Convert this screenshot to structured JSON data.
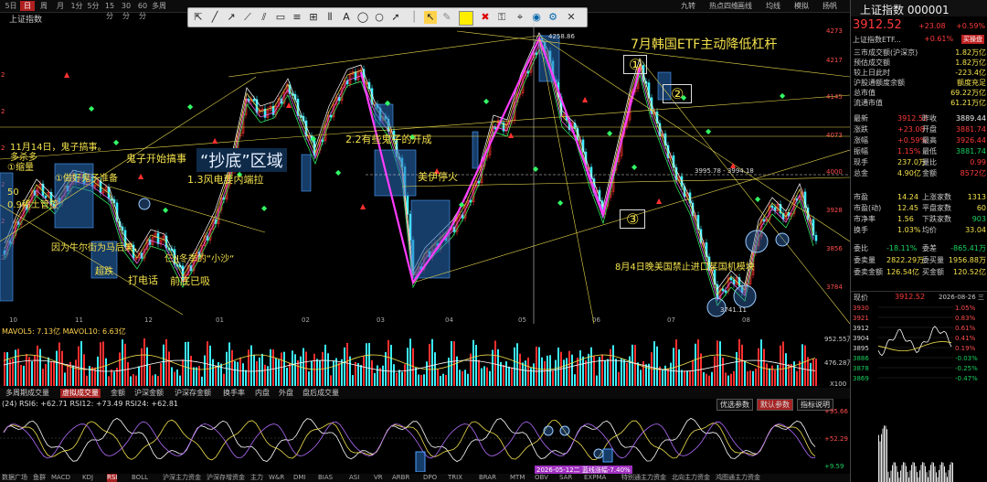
{
  "periods": [
    "5日",
    "日",
    "周",
    "月",
    "1分",
    "5分",
    "15分",
    "30分",
    "60分",
    "多周"
  ],
  "active_period": "日",
  "right_tabs": [
    "九转",
    "热点四维",
    "画线",
    "均线",
    "模拟",
    "扬帆"
  ],
  "chart_title": "上证指数",
  "price_axis": [
    "4273",
    "4217",
    "4145",
    "4073",
    "4000",
    "3928",
    "3856",
    "3784"
  ],
  "month_axis": [
    "10",
    "11",
    "12",
    "01",
    "02",
    "03",
    "04",
    "05",
    "06",
    "07",
    "08"
  ],
  "annotations": {
    "nov14": "11月14日，鬼子搞事。",
    "duo_sha": "多杀多",
    "suo_liang": "①缩量",
    "guizi_ready": "①做好鬼子准备",
    "guizi_start": "鬼子开始搞事",
    "chaodi": "“抄底”区域",
    "ratio_1_3": "1.3风电要内端拉",
    "note_2_2": "2.2有些鬼子的开成",
    "fed": "美伊停火",
    "korea": "7月韩国ETF主动降低杠杆",
    "aug4": "8月4日晚美国禁止进口某国机模块",
    "pct_50": "50",
    "xi_tu": "0.9稀土管控",
    "usjp": "因为牛尔街为马后果，",
    "chao_die": "超跌",
    "dial": "打电话",
    "prev_bottom": "前底已吸",
    "jj": "仨JJ冬季的“小沙“",
    "price_high": "4258.86",
    "price_low": "3741.11",
    "right_note": "3995.78 - 3994.18",
    "circle1": "①",
    "circle2": "②",
    "circle3": "③",
    "date_marker": "2026-05-12二 蓝线涨幅-7.40%"
  },
  "volume": {
    "header": "MAVOL5: 7.13亿  MAVOL10: 6.63亿",
    "axis_top": "952.55万",
    "axis_mid": "476.28万",
    "axis_unit": "X100"
  },
  "volume_tabs": [
    "多周期成交量",
    "虚拟成交量",
    "金额",
    "沪深金额",
    "沪深存金额",
    "换手率",
    "内盘",
    "外盘",
    "盘后成交量"
  ],
  "active_volume_tab": "虚拟成交量",
  "rsi": {
    "label": "(24) RSI6: +62.71  RSI12: +73.49  RSI24: +62.81",
    "buttons": [
      "优选参数",
      "默认参数",
      "指标说明"
    ],
    "axis": [
      "+95.66",
      "+52.29",
      "+9.59"
    ]
  },
  "bottom_tabs": [
    "数据广场",
    "鱼群",
    "MACD",
    "KDJ",
    "RSI",
    "BOLL",
    "沪深主力资金",
    "沪深存增资金",
    "主力",
    "W&R",
    "DMI",
    "BIAS",
    "ASI",
    "VR",
    "ARBR",
    "DPO",
    "TRIX",
    "BRAR",
    "MTM",
    "OBV",
    "SAR",
    "EXPMA",
    "特别通主力资金",
    "北向主力资金",
    "鸿图通主力资金"
  ],
  "active_bottom_tab": "RSI",
  "quote": {
    "title": "上证指数 000001",
    "price": "3912.52",
    "change": "+23.08",
    "pct": "+0.59%",
    "badge": "买操盘",
    "etf_label": "上证指数ETF...",
    "etf_pct": "+0.61%",
    "rows": [
      {
        "l": "三市成交额(沪深京)",
        "v": "1.82万亿"
      },
      {
        "l": "预估成交额",
        "v": "1.82万亿"
      },
      {
        "l": "较上日此时",
        "v": "-223.4亿"
      },
      {
        "l": "沪股通额度余额",
        "v": "额度充足"
      },
      {
        "l": "总市值",
        "v": "69.22万亿"
      },
      {
        "l": "流通市值",
        "v": "61.21万亿"
      }
    ],
    "grid": [
      [
        "最新",
        "3912.52",
        "昨收",
        "3889.44"
      ],
      [
        "涨跌",
        "+23.08",
        "开盘",
        "3881.74"
      ],
      [
        "涨幅",
        "+0.59%",
        "最高",
        "3926.44"
      ],
      [
        "振幅",
        "1.15%",
        "最低",
        "3881.74"
      ],
      [
        "现手",
        "237.0万",
        "量比",
        "0.99"
      ],
      [
        "总金",
        "4.90亿",
        "金额",
        "8572亿"
      ]
    ],
    "stats": [
      [
        "市盈",
        "14.24",
        "上涨家数",
        "1313"
      ],
      [
        "市盈(动)",
        "12.45",
        "平盘家数",
        "60"
      ],
      [
        "市净率",
        "1.56",
        "下跌家数",
        "903"
      ],
      [
        "换手",
        "1.03%",
        "均价",
        "33.04"
      ]
    ],
    "bidask": [
      [
        "委比",
        "-18.11%",
        "委差",
        "-865.41万"
      ],
      [
        "委卖量",
        "2822.29万",
        "委买量",
        "1956.88万"
      ],
      [
        "委卖金额",
        "126.54亿",
        "买金额",
        "120.52亿"
      ]
    ],
    "now_label": "现价",
    "now_price": "3912.52",
    "now_date": "2026-08-26 三",
    "mini_axis": [
      "3930",
      "3921",
      "3912",
      "3904",
      "3895",
      "3886",
      "3878",
      "3869"
    ],
    "mini_pct": [
      "1.05%",
      "0.83%",
      "0.61%",
      "0.41%",
      "0.19%",
      "-0.03%",
      "-0.25%",
      "-0.47%"
    ]
  }
}
